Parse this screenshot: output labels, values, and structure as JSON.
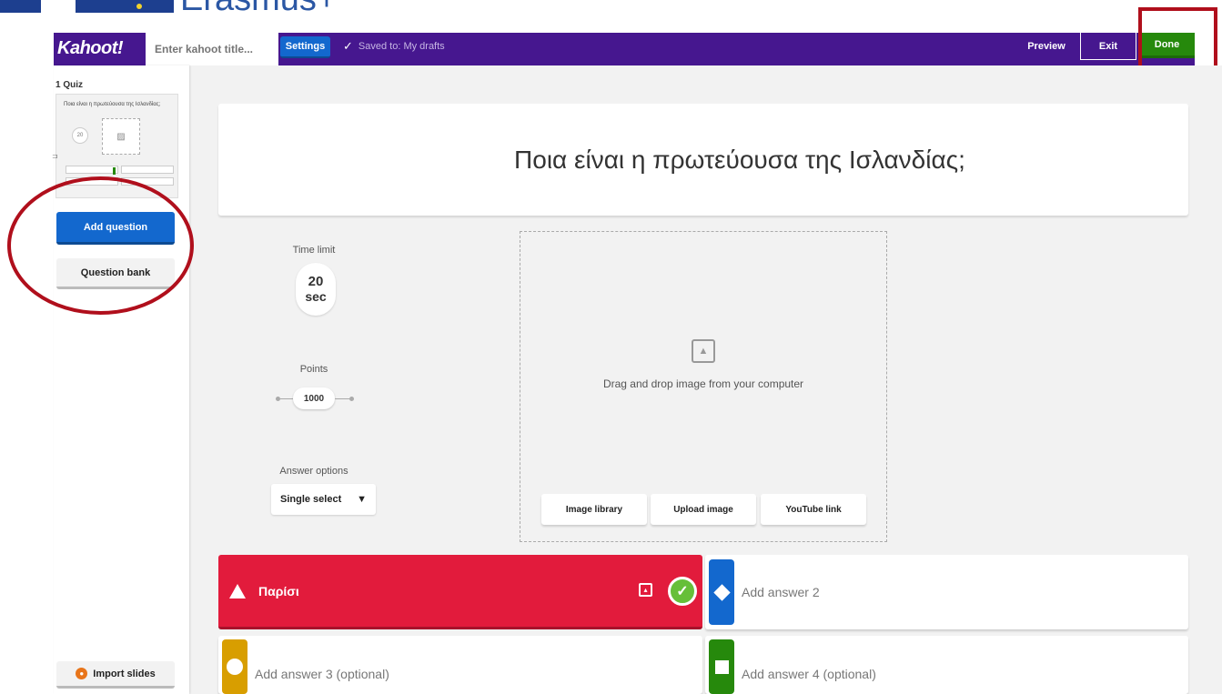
{
  "branding": {
    "program_name": "Erasmus+"
  },
  "header": {
    "logo": "Kahoot!",
    "title_placeholder": "Enter kahoot title...",
    "settings_label": "Settings",
    "saved_text": "Saved to: My drafts",
    "preview_label": "Preview",
    "exit_label": "Exit",
    "done_label": "Done"
  },
  "sidebar": {
    "quiz_label": "1  Quiz",
    "thumbnail": {
      "question": "Ποια είναι η πρωτεύουσα της Ισλανδίας;",
      "timer": "20"
    },
    "add_question_label": "Add question",
    "question_bank_label": "Question bank",
    "import_slides_label": "Import slides"
  },
  "editor": {
    "question": "Ποια είναι η πρωτεύουσα της Ισλανδίας;",
    "time_limit_label": "Time limit",
    "time_limit_value": "20",
    "time_limit_unit": "sec",
    "points_label": "Points",
    "points_value": "1000",
    "answer_options_label": "Answer options",
    "answer_options_value": "Single select",
    "media": {
      "drop_text": "Drag and drop image from your computer",
      "image_library_label": "Image library",
      "upload_image_label": "Upload image",
      "youtube_link_label": "YouTube link"
    },
    "answers": [
      {
        "text": "Παρίσι",
        "color": "#e21b3c",
        "shape": "triangle",
        "correct": true
      },
      {
        "placeholder": "Add answer 2",
        "color": "#1368ce",
        "shape": "diamond"
      },
      {
        "placeholder": "Add answer 3 (optional)",
        "color": "#d89e00",
        "shape": "circle"
      },
      {
        "placeholder": "Add answer 4 (optional)",
        "color": "#26890c",
        "shape": "square"
      }
    ]
  },
  "colors": {
    "header_purple": "#46178f",
    "primary_blue": "#1368ce",
    "done_green": "#26890c",
    "highlight_red": "#b00f1c"
  }
}
